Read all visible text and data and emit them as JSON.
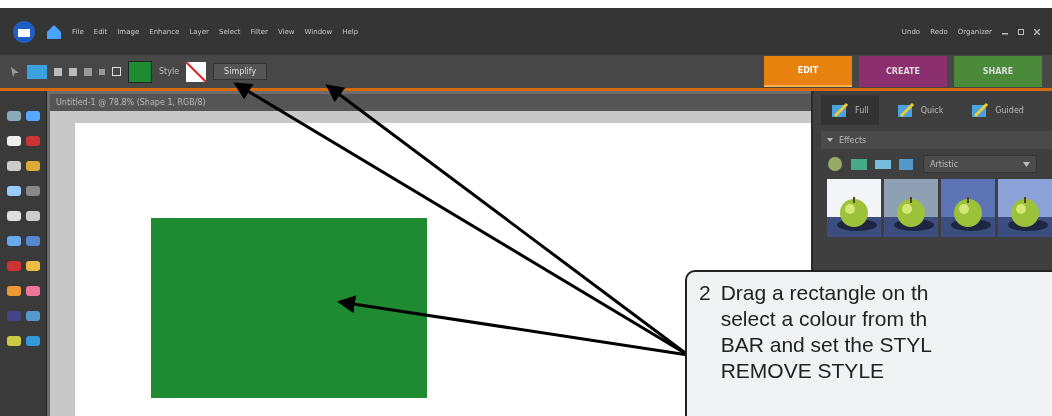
{
  "menu_bar": {
    "items": [
      "File",
      "Edit",
      "Image",
      "Enhance",
      "Layer",
      "Select",
      "Filter",
      "View",
      "Window",
      "Help"
    ],
    "actions": [
      "Undo",
      "Redo",
      "Organizer"
    ]
  },
  "options_bar": {
    "style_label": "Style",
    "button": "Simplify"
  },
  "panel_tabs": [
    {
      "label": "EDIT",
      "selected": true,
      "color": "#e8820e"
    },
    {
      "label": "CREATE",
      "selected": false,
      "color": "#8c2f6e"
    },
    {
      "label": "SHARE",
      "selected": false,
      "color": "#4b8a3a"
    }
  ],
  "modes": [
    {
      "label": "Full",
      "selected": true
    },
    {
      "label": "Quick",
      "selected": false
    },
    {
      "label": "Guided",
      "selected": false
    }
  ],
  "document": {
    "title": "Untitled-1 @ 78.8% (Shape 1, RGB/8)"
  },
  "effects": {
    "title": "Effects",
    "expanded": true,
    "category": "Artistic"
  },
  "callout": {
    "number": "2",
    "lines": [
      "Drag a rectangle on th",
      "select a colour from th",
      "BAR and set the STYL",
      "REMOVE STYLE"
    ]
  }
}
